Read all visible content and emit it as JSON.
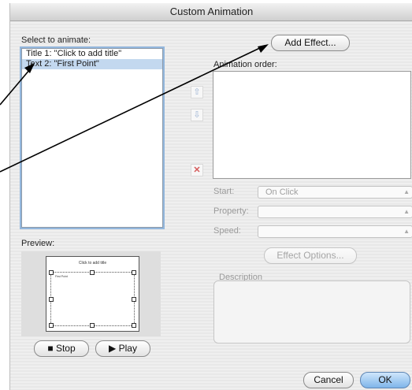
{
  "window": {
    "title": "Custom Animation"
  },
  "select_to_animate": {
    "label": "Select to animate:",
    "items": [
      "Title 1: \"Click to add title\"",
      "Text 2: \"First Point\""
    ]
  },
  "add_effect_label": "Add Effect...",
  "animation_order_label": "Animation order:",
  "start": {
    "label": "Start:",
    "value": "On Click"
  },
  "property": {
    "label": "Property:",
    "value": ""
  },
  "speed": {
    "label": "Speed:",
    "value": ""
  },
  "effect_options_label": "Effect Options...",
  "description_label": "Description",
  "preview": {
    "label": "Preview:",
    "slide_title": "Click to add title",
    "slide_point": "First Point"
  },
  "stop_label": "Stop",
  "play_label": "Play",
  "cancel_label": "Cancel",
  "ok_label": "OK",
  "icons": {
    "move_up": "up-arrow-icon",
    "move_down": "down-arrow-icon",
    "remove": "remove-x-icon",
    "stop": "stop-square-icon",
    "play": "play-triangle-icon",
    "dropdown": "updown-chevron-icon"
  }
}
